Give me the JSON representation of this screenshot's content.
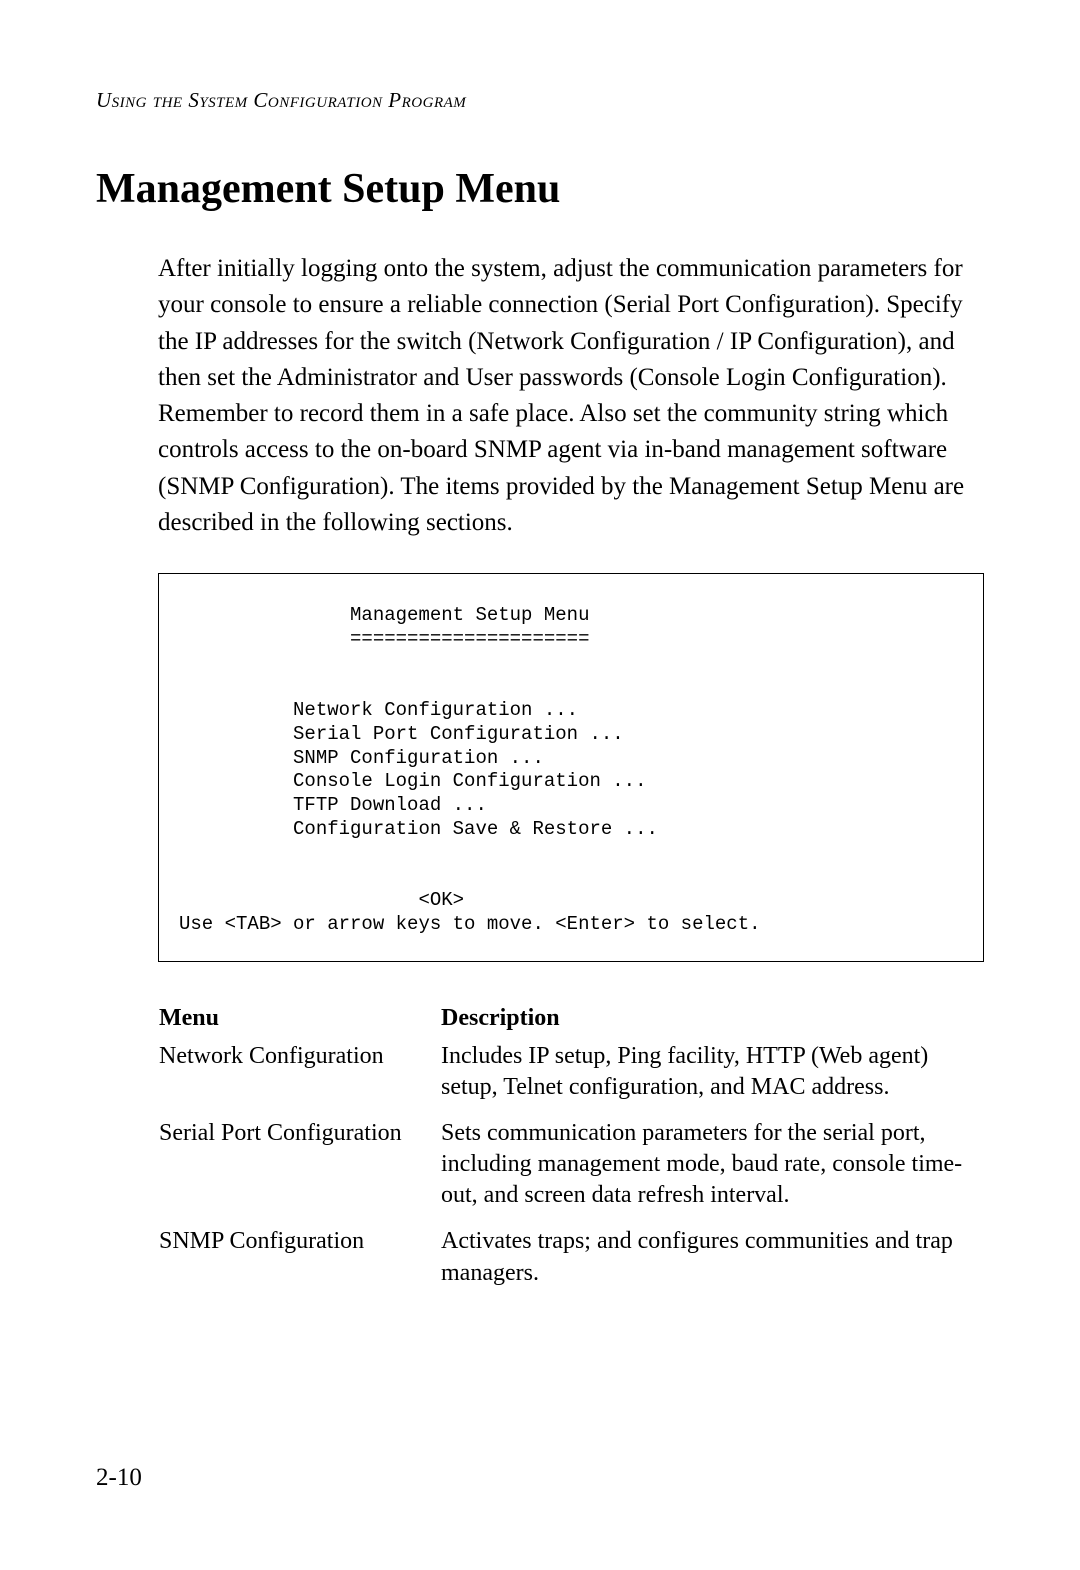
{
  "header": {
    "running": "Using the System Configuration Program"
  },
  "title": "Management Setup Menu",
  "paragraph": "After initially logging onto the system, adjust the communication parameters for your console to ensure a reliable connection (Serial Port Configuration). Specify the IP addresses for the switch (Network Configuration / IP Configuration), and then set the Administrator and User passwords (Console Login Configuration). Remember to record them in a safe place. Also set the community string which controls access to the on-board SNMP agent via in-band management software (SNMP Configuration). The items provided by the Management Setup Menu are described in the following sections.",
  "terminal": {
    "title": "               Management Setup Menu",
    "rule": "               =====================",
    "items": [
      "          Network Configuration ...",
      "          Serial Port Configuration ...",
      "          SNMP Configuration ...",
      "          Console Login Configuration ...",
      "          TFTP Download ...",
      "          Configuration Save & Restore ..."
    ],
    "ok": "                     <OK>",
    "hint": "Use <TAB> or arrow keys to move. <Enter> to select."
  },
  "table": {
    "headers": {
      "menu": "Menu",
      "description": "Description"
    },
    "rows": [
      {
        "menu": "Network Configuration",
        "description": "Includes IP setup, Ping facility, HTTP (Web agent) setup, Telnet configuration, and MAC address."
      },
      {
        "menu": "Serial Port Configuration",
        "description": "Sets communication parameters for the serial port, including management mode, baud rate, console time-out, and screen data refresh interval."
      },
      {
        "menu": "SNMP Configuration",
        "description": "Activates traps; and configures communities and trap managers."
      }
    ]
  },
  "page_number": "2-10"
}
